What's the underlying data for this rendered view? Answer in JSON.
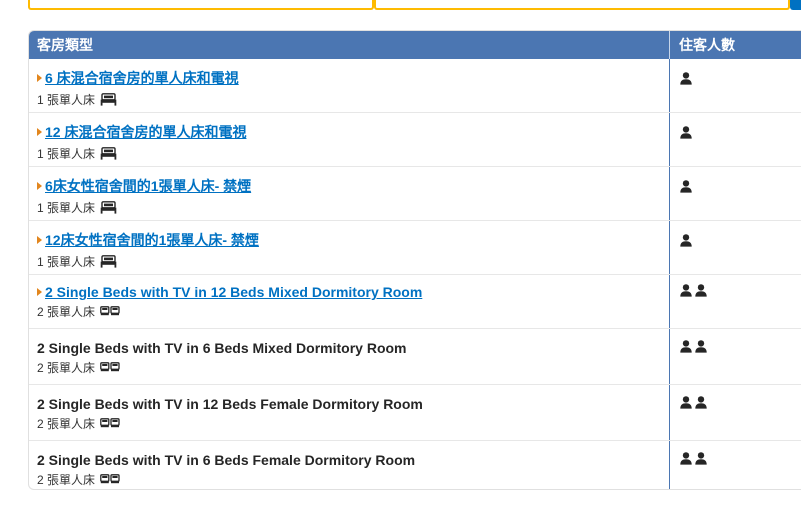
{
  "table": {
    "col_type": "客房類型",
    "col_guests": "住客人數"
  },
  "rooms": [
    {
      "name": "6 床混合宿舍房的單人床和電視",
      "linked": true,
      "bed": "1 張單人床",
      "guests": 1,
      "bed_icon": "single-bed-icon"
    },
    {
      "name": "12 床混合宿舍房的單人床和電視",
      "linked": true,
      "bed": "1 張單人床",
      "guests": 1,
      "bed_icon": "single-bed-icon"
    },
    {
      "name": "6床女性宿舍間的1張單人床- 禁煙",
      "linked": true,
      "bed": "1 張單人床",
      "guests": 1,
      "bed_icon": "single-bed-icon"
    },
    {
      "name": "12床女性宿舍間的1張單人床- 禁煙",
      "linked": true,
      "bed": "1 張單人床",
      "guests": 1,
      "bed_icon": "single-bed-icon"
    },
    {
      "name": "2 Single Beds with TV in 12 Beds Mixed Dormitory Room",
      "linked": true,
      "bed": "2 張單人床",
      "guests": 2,
      "bed_icon": "two-single-beds-icon"
    },
    {
      "name": "2 Single Beds with TV in 6 Beds Mixed Dormitory Room",
      "linked": false,
      "bed": "2 張單人床",
      "guests": 2,
      "bed_icon": "two-single-beds-icon"
    },
    {
      "name": "2 Single Beds with TV in 12 Beds Female Dormitory Room",
      "linked": false,
      "bed": "2 張單人床",
      "guests": 2,
      "bed_icon": "two-single-beds-icon"
    },
    {
      "name": "2 Single Beds with TV in 6 Beds Female Dormitory Room",
      "linked": false,
      "bed": "2 張單人床",
      "guests": 2,
      "bed_icon": "two-single-beds-icon"
    }
  ],
  "colors": {
    "header_bg": "#4b76b2",
    "link": "#0071c2",
    "caret": "#e2861e",
    "input_border": "#febb02"
  }
}
